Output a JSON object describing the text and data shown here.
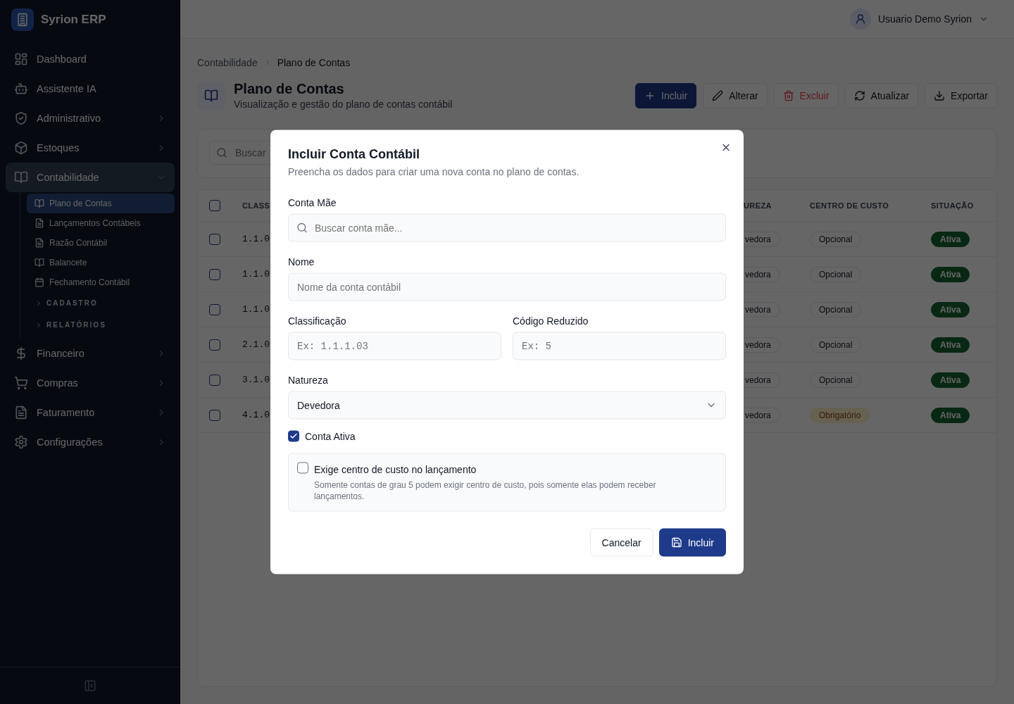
{
  "app": {
    "name": "Syrion ERP"
  },
  "sidebar": {
    "items": [
      {
        "label": "Dashboard",
        "kind": "link"
      },
      {
        "label": "Assistente IA",
        "kind": "link"
      },
      {
        "label": "Administrativo",
        "kind": "group",
        "expanded": false
      },
      {
        "label": "Estoques",
        "kind": "group",
        "expanded": false
      },
      {
        "label": "Contabilidade",
        "kind": "group",
        "expanded": true,
        "children": [
          {
            "label": "Plano de Contas",
            "kind": "link",
            "selected": true
          },
          {
            "label": "Lançamentos Contábeis",
            "kind": "link",
            "selected": false
          },
          {
            "label": "Razão Contábil",
            "kind": "link",
            "selected": false
          },
          {
            "label": "Balancete",
            "kind": "link",
            "selected": false
          },
          {
            "label": "Fechamento Contábil",
            "kind": "link",
            "selected": false
          },
          {
            "label": "CADASTRO",
            "kind": "section",
            "expanded": false
          },
          {
            "label": "RELATÓRIOS",
            "kind": "section",
            "expanded": false
          }
        ]
      },
      {
        "label": "Financeiro",
        "kind": "group",
        "expanded": false
      },
      {
        "label": "Compras",
        "kind": "group",
        "expanded": false
      },
      {
        "label": "Faturamento",
        "kind": "group",
        "expanded": false
      },
      {
        "label": "Configurações",
        "kind": "group",
        "expanded": false
      }
    ]
  },
  "topbar": {
    "user": "Usuario Demo Syrion"
  },
  "breadcrumb": [
    "Contabilidade",
    "Plano de Contas"
  ],
  "page": {
    "title": "Plano de Contas",
    "subtitle": "Visualização e gestão do plano de contas contábil"
  },
  "toolbar": [
    {
      "label": "Incluir",
      "kind": "primary"
    },
    {
      "label": "Alterar",
      "kind": "default"
    },
    {
      "label": "Excluir",
      "kind": "danger"
    },
    {
      "label": "Atualizar",
      "kind": "default"
    },
    {
      "label": "Exportar",
      "kind": "default"
    }
  ],
  "search": {
    "placeholder": "Buscar"
  },
  "table": {
    "header_checked": false,
    "columns": [
      "CLASS",
      "UREZA",
      "CENTRO DE CUSTO",
      "SITUAÇÃO"
    ],
    "rows": [
      {
        "checked": false,
        "classification": "1.1.0",
        "nature": "vedora",
        "cost_center": {
          "text": "Opcional",
          "kind": "optional"
        },
        "status": "Ativa"
      },
      {
        "checked": false,
        "classification": "1.1.0",
        "nature": "vedora",
        "cost_center": {
          "text": "Opcional",
          "kind": "optional"
        },
        "status": "Ativa"
      },
      {
        "checked": false,
        "classification": "1.1.0",
        "nature": "vedora",
        "cost_center": {
          "text": "Opcional",
          "kind": "optional"
        },
        "status": "Ativa"
      },
      {
        "checked": false,
        "classification": "2.1.0",
        "nature": "vedora",
        "cost_center": {
          "text": "Opcional",
          "kind": "optional"
        },
        "status": "Ativa"
      },
      {
        "checked": false,
        "classification": "3.1.0",
        "nature": "vedora",
        "cost_center": {
          "text": "Opcional",
          "kind": "optional"
        },
        "status": "Ativa"
      },
      {
        "checked": false,
        "classification": "4.1.0",
        "nature": "vedora",
        "cost_center": {
          "text": "Obrigatório",
          "kind": "required"
        },
        "status": "Ativa"
      }
    ]
  },
  "modal": {
    "title": "Incluir Conta Contábil",
    "subtitle": "Preencha os dados para criar uma nova conta no plano de contas.",
    "parent": {
      "label": "Conta Mãe",
      "placeholder": "Buscar conta mãe..."
    },
    "name": {
      "label": "Nome",
      "placeholder": "Nome da conta contábil"
    },
    "classification": {
      "label": "Classificação",
      "placeholder": "Ex: 1.1.1.03"
    },
    "short_code": {
      "label": "Código Reduzido",
      "placeholder": "Ex: 5"
    },
    "nature": {
      "label": "Natureza",
      "value": "Devedora"
    },
    "active": {
      "label": "Conta Ativa",
      "checked": true
    },
    "requires_cost_center": {
      "label": "Exige centro de custo no lançamento",
      "hint": "Somente contas de grau 5 podem exigir centro de custo, pois somente elas podem receber lançamentos.",
      "checked": false
    },
    "buttons": [
      {
        "label": "Cancelar",
        "kind": "default"
      },
      {
        "label": "Incluir",
        "kind": "primary"
      }
    ]
  }
}
